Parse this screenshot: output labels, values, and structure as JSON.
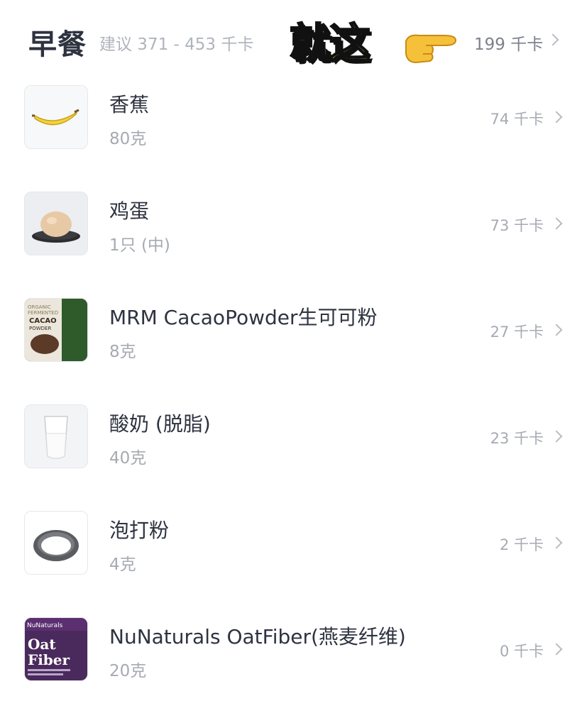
{
  "header": {
    "meal_title": "早餐",
    "suggestion": "建议 371 - 453 千卡",
    "sticker_text": "就这",
    "total_kcal": "199 千卡"
  },
  "foods": [
    {
      "name": "香蕉",
      "portion": "80克",
      "kcal": "74 千卡",
      "thumb_icon": "banana-icon"
    },
    {
      "name": "鸡蛋",
      "portion": "1只 (中)",
      "kcal": "73 千卡",
      "thumb_icon": "egg-icon"
    },
    {
      "name": "MRM CacaoPowder生可可粉",
      "portion": "8克",
      "kcal": "27 千卡",
      "thumb_icon": "cacao-powder-bag-icon",
      "thumb_text": [
        "ORGANIC",
        "FERMENTED",
        "CACAO",
        "POWDER"
      ]
    },
    {
      "name": "酸奶 (脱脂)",
      "portion": "40克",
      "kcal": "23 千卡",
      "thumb_icon": "yogurt-glass-icon"
    },
    {
      "name": "泡打粉",
      "portion": "4克",
      "kcal": "2 千卡",
      "thumb_icon": "baking-powder-dish-icon"
    },
    {
      "name": "NuNaturals OatFiber(燕麦纤维)",
      "portion": "20克",
      "kcal": "0 千卡",
      "thumb_icon": "oat-fiber-bag-icon",
      "thumb_text": [
        "NuNaturals",
        "Oat",
        "Fiber"
      ]
    }
  ],
  "colors": {
    "title": "#2e3340",
    "muted": "#a6aab2",
    "sticker_fill": "#f4dc45",
    "sticker_outline": "#111111"
  }
}
